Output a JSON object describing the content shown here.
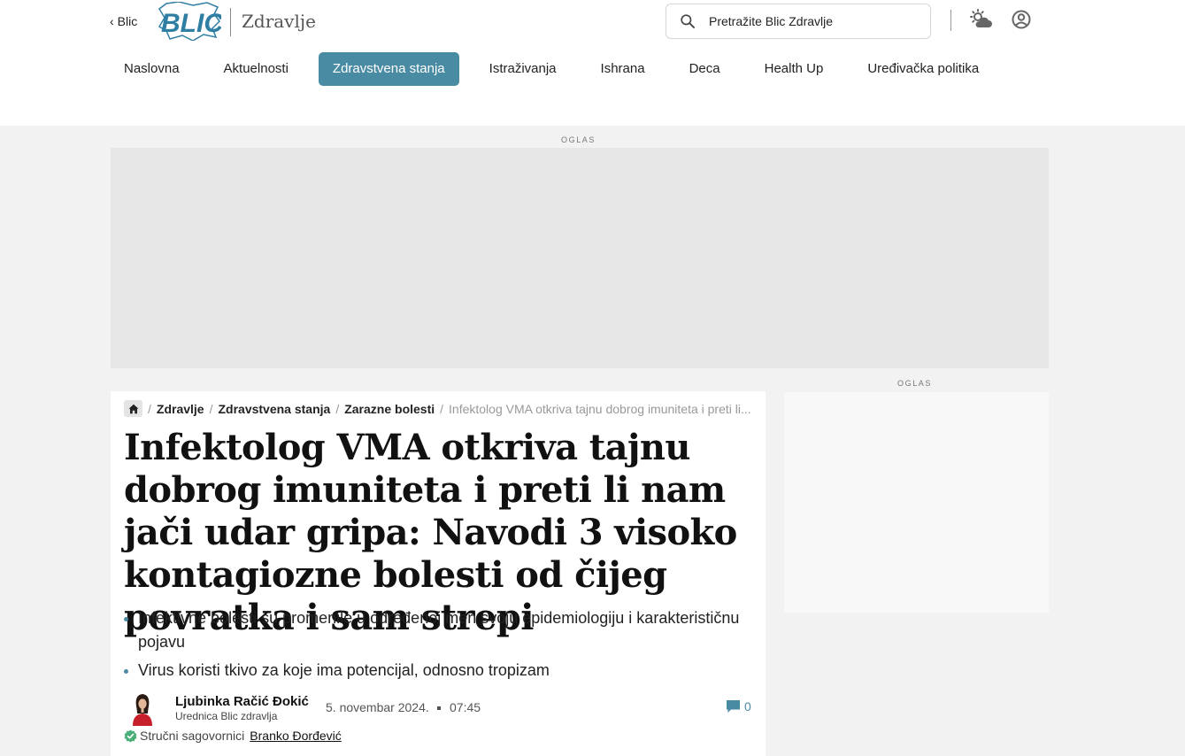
{
  "header": {
    "back_label": "Blic",
    "logo_text": "BLIC",
    "section_name": "Zdravlje",
    "search_placeholder": "Pretražite Blic Zdravlje",
    "icons": [
      "search-icon",
      "weather-icon",
      "user-account-icon",
      "chevron-left-icon",
      "home-icon",
      "comment-icon",
      "verified-check-icon"
    ]
  },
  "nav": {
    "items": [
      {
        "label": "Naslovna",
        "active": false
      },
      {
        "label": "Aktuelnosti",
        "active": false
      },
      {
        "label": "Zdravstvena stanja",
        "active": true
      },
      {
        "label": "Istraživanja",
        "active": false
      },
      {
        "label": "Ishrana",
        "active": false
      },
      {
        "label": "Deca",
        "active": false
      },
      {
        "label": "Health Up",
        "active": false
      },
      {
        "label": "Uređivačka politika",
        "active": false
      }
    ]
  },
  "ads": {
    "top_label": "OGLAS",
    "side_label": "OGLAS"
  },
  "breadcrumb": {
    "items": [
      "Zdravlje",
      "Zdravstvena stanja",
      "Zarazne bolesti"
    ],
    "current": "Infektolog VMA otkriva tajnu dobrog imuniteta i preti li..."
  },
  "article": {
    "title": "Infektolog VMA otkriva tajnu dobrog imuniteta i preti li nam jači udar gripa: Navodi 3 visoko kontagiozne bolesti od čijeg povratka i sam strepi",
    "highlights": [
      "Infektivne bolesti su promenile u određenoj meri svoju epidemiologiju i karakterističnu pojavu",
      "Virus koristi tkivo za koje ima potencijal, odnosno tropizam"
    ],
    "author_name": "Ljubinka Račić Đokić",
    "author_role": "Urednica Blic zdravlja",
    "date": "5. novembar 2024.",
    "time": "07:45",
    "comment_count": "0",
    "experts_label": "Stručni sagovornici",
    "expert_name": "Branko Đorđević"
  },
  "colors": {
    "accent": "#4a8ba4",
    "logo_blue": "#2f7ea3",
    "page_bg": "#f2f2f2",
    "ad_bg": "#e6e6e6",
    "verified_green": "#4caf7a"
  }
}
